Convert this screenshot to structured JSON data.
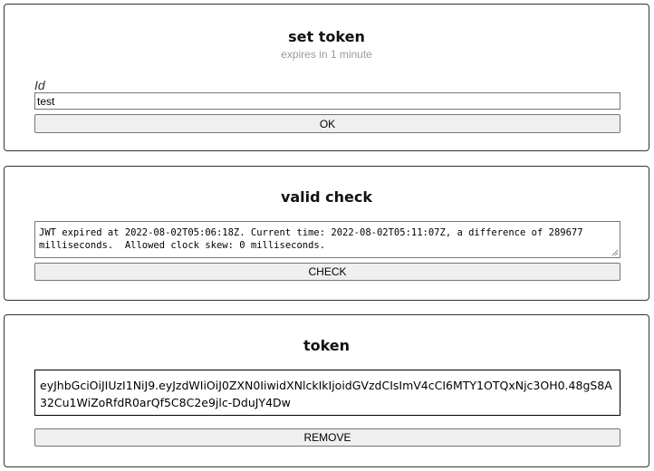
{
  "set_token": {
    "title": "set token",
    "subtitle": "expires in 1 minute",
    "id_label": "Id",
    "id_value": "test",
    "ok_label": "OK"
  },
  "valid_check": {
    "title": "valid check",
    "message": "JWT expired at 2022-08-02T05:06:18Z. Current time: 2022-08-02T05:11:07Z, a difference of 289677 milliseconds.  Allowed clock skew: 0 milliseconds.",
    "check_label": "CHECK"
  },
  "token": {
    "title": "token",
    "value": "eyJhbGciOiJIUzI1NiJ9.eyJzdWIiOiJ0ZXN0IiwidXNlckIkIjoidGVzdCIsImV4cCI6MTY1OTQxNjc3OH0.48gS8A32Cu1WiZoRfdR0arQf5C8C2e9jlc-DduJY4Dw",
    "remove_label": "REMOVE"
  }
}
